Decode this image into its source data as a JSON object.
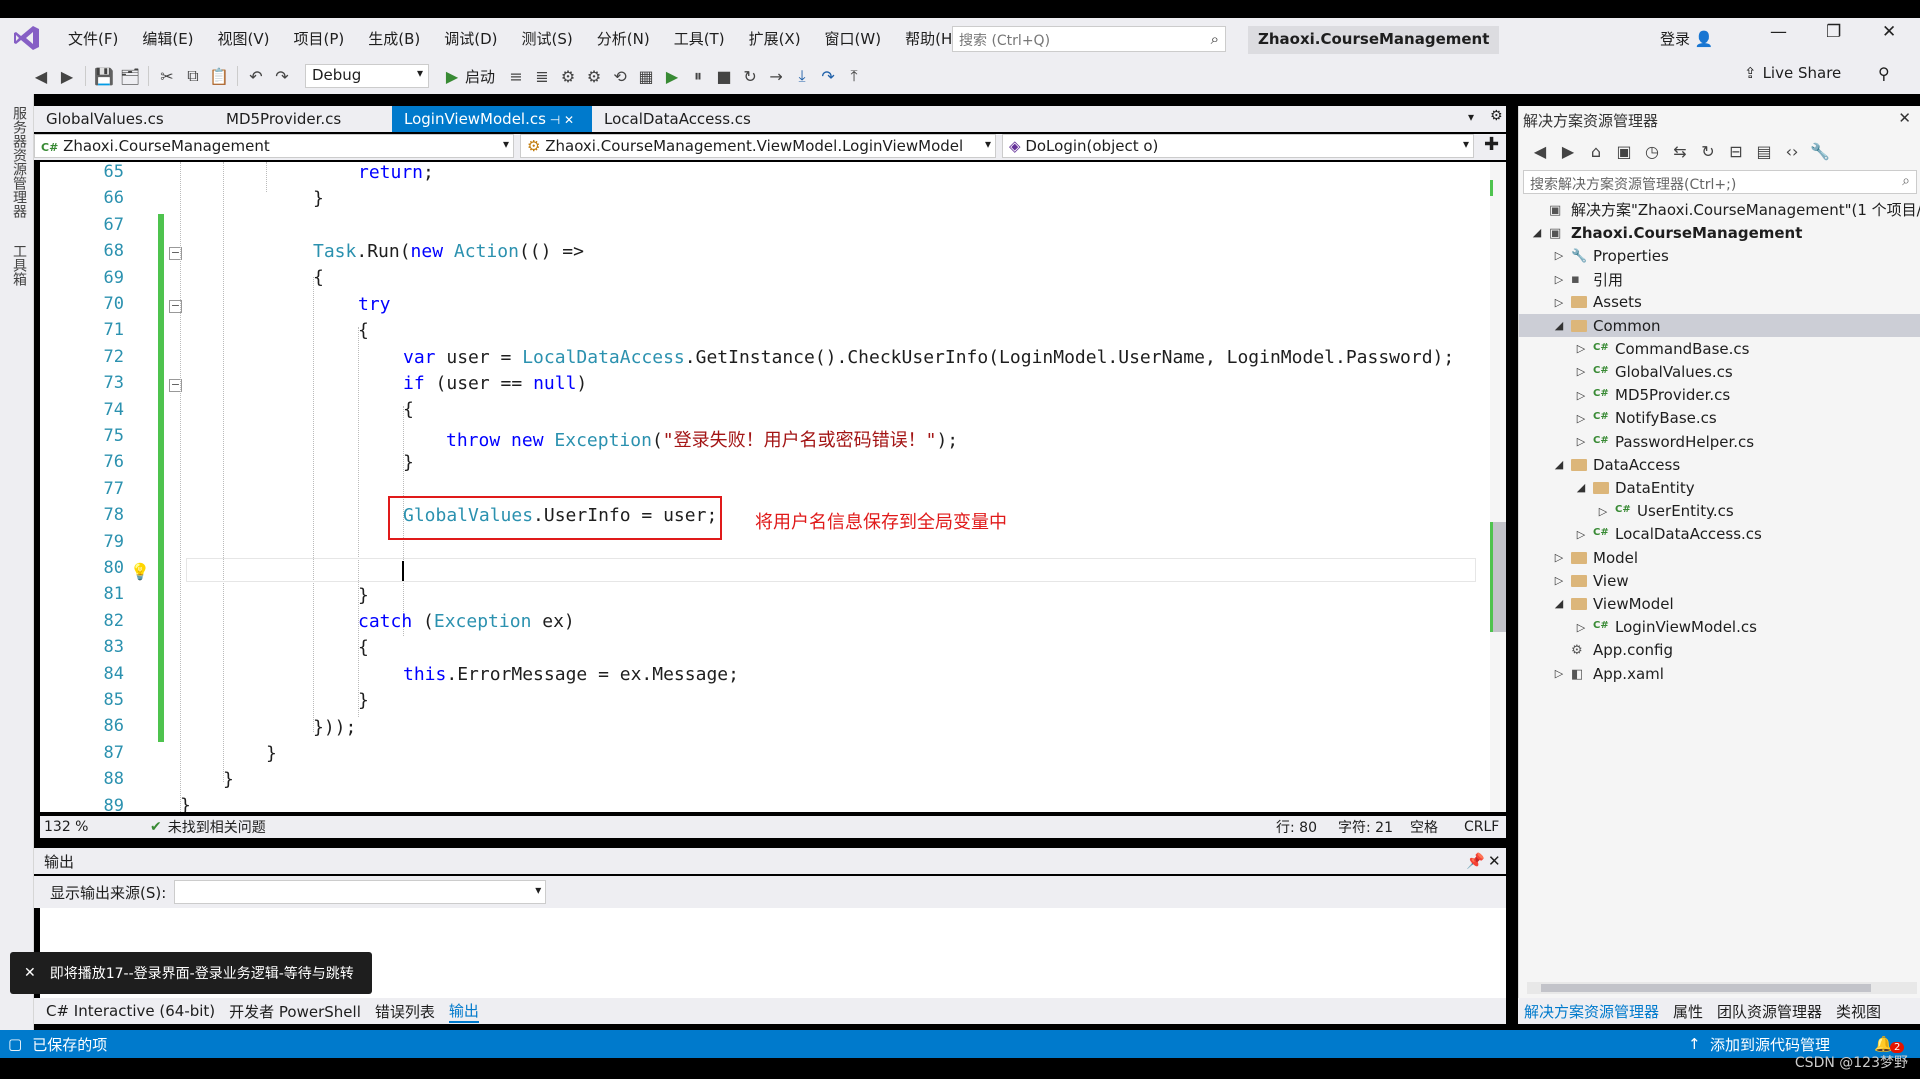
{
  "titlebar": {
    "menus": [
      "文件(F)",
      "编辑(E)",
      "视图(V)",
      "项目(P)",
      "生成(B)",
      "调试(D)",
      "测试(S)",
      "分析(N)",
      "工具(T)",
      "扩展(X)",
      "窗口(W)",
      "帮助(H)"
    ],
    "search_placeholder": "搜索 (Ctrl+Q)",
    "project_name": "Zhaoxi.CourseManagement",
    "login": "登录"
  },
  "toolbar": {
    "config": "Debug",
    "start_label": "启动",
    "live_share": "Live Share"
  },
  "left_strip": {
    "server_explorer": "服务器资源管理器",
    "toolbox": "工具箱"
  },
  "tabs": [
    {
      "label": "GlobalValues.cs",
      "active": false
    },
    {
      "label": "MD5Provider.cs",
      "active": false
    },
    {
      "label": "LoginViewModel.cs",
      "active": true
    },
    {
      "label": "LocalDataAccess.cs",
      "active": false
    }
  ],
  "navbar": {
    "project": "Zhaoxi.CourseManagement",
    "class": "Zhaoxi.CourseManagement.ViewModel.LoginViewModel",
    "member": "DoLogin(object o)"
  },
  "editor": {
    "line_numbers": [
      "65",
      "66",
      "67",
      "68",
      "69",
      "70",
      "71",
      "72",
      "73",
      "74",
      "75",
      "76",
      "77",
      "78",
      "79",
      "80",
      "81",
      "82",
      "83",
      "84",
      "85",
      "86",
      "87",
      "88",
      "89"
    ],
    "annotation": "将用户名信息保存到全局变量中"
  },
  "editor_status": {
    "zoom": "132 %",
    "issues": "未找到相关问题",
    "line": "行: 80",
    "char": "字符: 21",
    "spaces": "空格",
    "eol": "CRLF"
  },
  "output": {
    "title": "输出",
    "source_label": "显示输出来源(S):",
    "source_value": ""
  },
  "toast": "即将播放17--登录界面-登录业务逻辑-等待与跳转",
  "bottom_tabs": [
    "C# Interactive (64-bit)",
    "开发者 PowerShell",
    "错误列表",
    "输出"
  ],
  "solution_explorer": {
    "title": "解决方案资源管理器",
    "search_placeholder": "搜索解决方案资源管理器(Ctrl+;)",
    "items": [
      {
        "label": "解决方案\"Zhaoxi.CourseManagement\"(1 个项目/共",
        "indent": 0,
        "arrow": "",
        "icon": "solution",
        "bold": false
      },
      {
        "label": "Zhaoxi.CourseManagement",
        "indent": 0,
        "arrow": "◢",
        "icon": "project",
        "bold": true
      },
      {
        "label": "Properties",
        "indent": 1,
        "arrow": "▷",
        "icon": "wrench",
        "bold": false
      },
      {
        "label": "引用",
        "indent": 1,
        "arrow": "▷",
        "icon": "refs",
        "bold": false
      },
      {
        "label": "Assets",
        "indent": 1,
        "arrow": "▷",
        "icon": "folder",
        "bold": false
      },
      {
        "label": "Common",
        "indent": 1,
        "arrow": "◢",
        "icon": "folder",
        "bold": false,
        "selected": true
      },
      {
        "label": "CommandBase.cs",
        "indent": 2,
        "arrow": "▷",
        "icon": "cs",
        "bold": false
      },
      {
        "label": "GlobalValues.cs",
        "indent": 2,
        "arrow": "▷",
        "icon": "cs",
        "bold": false
      },
      {
        "label": "MD5Provider.cs",
        "indent": 2,
        "arrow": "▷",
        "icon": "cs",
        "bold": false
      },
      {
        "label": "NotifyBase.cs",
        "indent": 2,
        "arrow": "▷",
        "icon": "cs",
        "bold": false
      },
      {
        "label": "PasswordHelper.cs",
        "indent": 2,
        "arrow": "▷",
        "icon": "cs",
        "bold": false
      },
      {
        "label": "DataAccess",
        "indent": 1,
        "arrow": "◢",
        "icon": "folder",
        "bold": false
      },
      {
        "label": "DataEntity",
        "indent": 2,
        "arrow": "◢",
        "icon": "folder",
        "bold": false
      },
      {
        "label": "UserEntity.cs",
        "indent": 3,
        "arrow": "▷",
        "icon": "cs",
        "bold": false
      },
      {
        "label": "LocalDataAccess.cs",
        "indent": 2,
        "arrow": "▷",
        "icon": "cs",
        "bold": false
      },
      {
        "label": "Model",
        "indent": 1,
        "arrow": "▷",
        "icon": "folder",
        "bold": false
      },
      {
        "label": "View",
        "indent": 1,
        "arrow": "▷",
        "icon": "folder",
        "bold": false
      },
      {
        "label": "ViewModel",
        "indent": 1,
        "arrow": "◢",
        "icon": "folder",
        "bold": false
      },
      {
        "label": "LoginViewModel.cs",
        "indent": 2,
        "arrow": "▷",
        "icon": "cs",
        "bold": false
      },
      {
        "label": "App.config",
        "indent": 1,
        "arrow": "",
        "icon": "config",
        "bold": false
      },
      {
        "label": "App.xaml",
        "indent": 1,
        "arrow": "▷",
        "icon": "xaml",
        "bold": false
      }
    ],
    "bottom_tabs": [
      "解决方案资源管理器",
      "属性",
      "团队资源管理器",
      "类视图"
    ]
  },
  "statusbar": {
    "left": "已保存的项",
    "right": "添加到源代码管理",
    "badge": "2"
  },
  "watermark": "CSDN @123梦野",
  "colors": {
    "accent": "#007acc",
    "keyword": "#0000ff",
    "type": "#2b91af",
    "string": "#a31515",
    "highlight": "#e01a1a"
  }
}
